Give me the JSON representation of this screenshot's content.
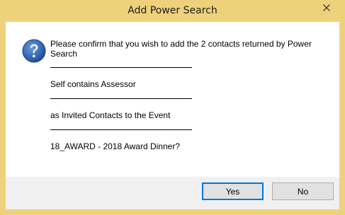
{
  "window": {
    "title": "Add Power Search"
  },
  "dialog": {
    "message_line1": "Please confirm that you wish to add the 2 contacts returned by Power",
    "message_line2": "Search",
    "search_name": "Self contains Assessor",
    "invite_text": "as Invited Contacts to the Event",
    "event_name": "18_AWARD - 2018 Award Dinner?"
  },
  "buttons": {
    "yes_label": "Yes",
    "no_label": "No"
  },
  "icons": {
    "close": "close-icon",
    "question": "question-icon"
  },
  "colors": {
    "title_bar": "#eed27b",
    "icon_blue": "#2d62b4",
    "default_button_border": "#0078d7"
  }
}
